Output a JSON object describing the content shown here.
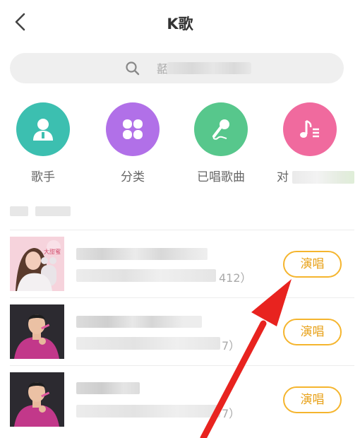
{
  "header": {
    "title": "K歌"
  },
  "search": {
    "placeholder": "嚭"
  },
  "categories": [
    {
      "label": "歌手",
      "icon": "singer-icon",
      "color": "#3cbfb0"
    },
    {
      "label": "分类",
      "icon": "clover-icon",
      "color": "#b170e8"
    },
    {
      "label": "已唱歌曲",
      "icon": "microphone-icon",
      "color": "#57c78c"
    },
    {
      "label": "对",
      "icon": "music-list-icon",
      "color": "#f06a9e"
    }
  ],
  "songs": [
    {
      "tail": "412）",
      "button": "演唱"
    },
    {
      "tail": "7）",
      "button": "演唱"
    },
    {
      "tail": "7）",
      "button": "演唱"
    }
  ],
  "colors": {
    "accent": "#f5b52e",
    "arrow": "#e8231f"
  }
}
